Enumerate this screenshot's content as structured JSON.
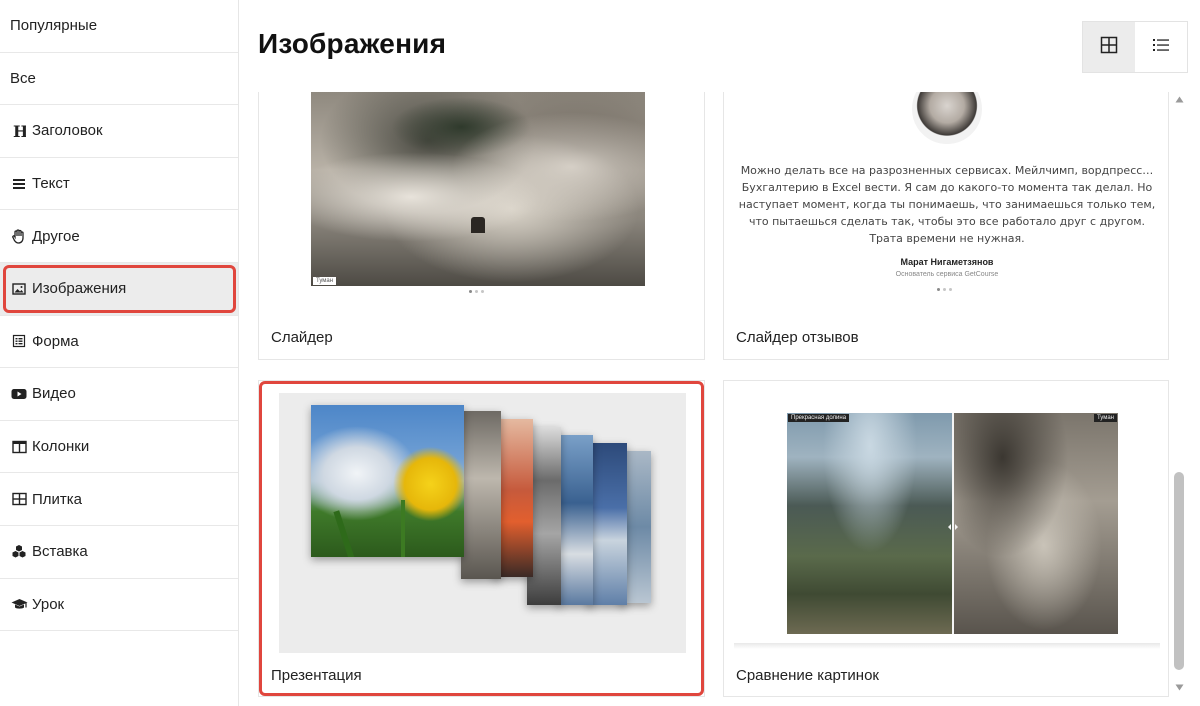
{
  "sidebar": {
    "items": [
      {
        "label": "Популярные",
        "icon": ""
      },
      {
        "label": "Все",
        "icon": ""
      },
      {
        "label": "Заголовок",
        "icon": "heading-icon"
      },
      {
        "label": "Текст",
        "icon": "text-lines-icon"
      },
      {
        "label": "Другое",
        "icon": "hand-icon"
      },
      {
        "label": "Изображения",
        "icon": "image-icon"
      },
      {
        "label": "Форма",
        "icon": "form-icon"
      },
      {
        "label": "Видео",
        "icon": "video-icon"
      },
      {
        "label": "Колонки",
        "icon": "columns-icon"
      },
      {
        "label": "Плитка",
        "icon": "tiles-icon"
      },
      {
        "label": "Вставка",
        "icon": "blocks-icon"
      },
      {
        "label": "Урок",
        "icon": "graduation-cap-icon"
      }
    ],
    "active_index": 5
  },
  "header": {
    "title": "Изображения"
  },
  "view_toggle": {
    "grid_icon": "grid-icon",
    "list_icon": "list-icon",
    "active": "grid"
  },
  "cards": {
    "slider": {
      "label": "Слайдер",
      "caption": "Туман"
    },
    "review_slider": {
      "label": "Слайдер отзывов",
      "text": "Можно делать все на разрозненных сервисах. Мейлчимп, вордпресс… Бухгалтерию в Excel вести. Я сам до какого-то момента так делал. Но наступает момент, когда ты понимаешь, что занимаешься только тем, что пытаешься сделать так, чтобы это все работало друг с другом. Трата времени не нужная.",
      "author": "Марат Нигаметзянов",
      "role": "Основатель сервиса GetCourse"
    },
    "presentation": {
      "label": "Презентация"
    },
    "image_compare": {
      "label": "Сравнение картинок",
      "left_caption": "Прекрасная долина",
      "right_caption": "Туман"
    }
  },
  "colors": {
    "highlight": "#e0463d",
    "active_bg": "#ececec"
  }
}
